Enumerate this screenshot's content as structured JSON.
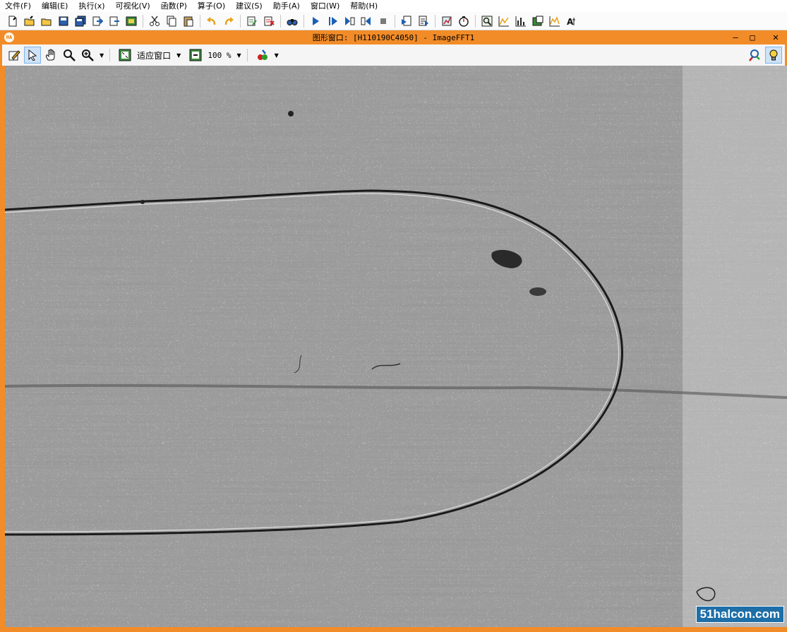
{
  "menu": [
    "文件(F)",
    "编辑(E)",
    "执行(x)",
    "可视化(V)",
    "函数(P)",
    "算子(O)",
    "建议(S)",
    "助手(A)",
    "窗口(W)",
    "帮助(H)"
  ],
  "graphics_window": {
    "title": "图形窗口: [H110190C4050] - ImageFFT1",
    "app_icon_text": "HA",
    "fit_label": "适应窗口",
    "zoom_label": "100 %"
  },
  "watermark": "51halcon.com",
  "colors": {
    "window_frame": "#f28c28",
    "image_bg": "#c9c9c9",
    "contour": "#1a1a1a"
  }
}
